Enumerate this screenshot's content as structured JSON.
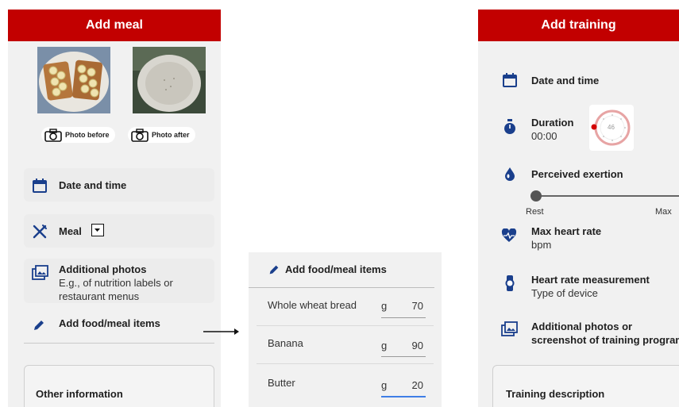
{
  "meal": {
    "header": "Add meal",
    "photo_before_label": "Photo before",
    "photo_after_label": "Photo after",
    "date_time": "Date and time",
    "meal_label": "Meal",
    "additional_photos_title": "Additional photos",
    "additional_photos_sub1": "E.g., of nutrition labels or",
    "additional_photos_sub2": "restaurant menus",
    "add_food_label": "Add food/meal items",
    "other_info": "Other information"
  },
  "food": {
    "title": "Add food/meal items",
    "items": [
      {
        "name": "Whole wheat bread",
        "unit": "g",
        "qty": "70"
      },
      {
        "name": "Banana",
        "unit": "g",
        "qty": "90"
      },
      {
        "name": "Butter",
        "unit": "g",
        "qty": "20"
      }
    ]
  },
  "training": {
    "header": "Add training",
    "date_time": "Date and time",
    "duration_title": "Duration",
    "duration_value": "00:00",
    "timer_center": "46",
    "exertion_title": "Perceived exertion",
    "exertion_value": 0.0,
    "rest_label": "Rest",
    "max_label": "Max",
    "max_hr_title": "Max heart rate",
    "max_hr_unit": "bpm",
    "hr_measure_title": "Heart rate measurement",
    "hr_measure_sub": "Type of device",
    "addl_photos_title": "Additional photos or",
    "addl_photos_sub": "screenshot of training program",
    "training_desc": "Training description"
  },
  "colors": {
    "header_red": "#c20000",
    "icon_blue": "#1a3f8c",
    "accent_blue": "#3f7ee6"
  }
}
